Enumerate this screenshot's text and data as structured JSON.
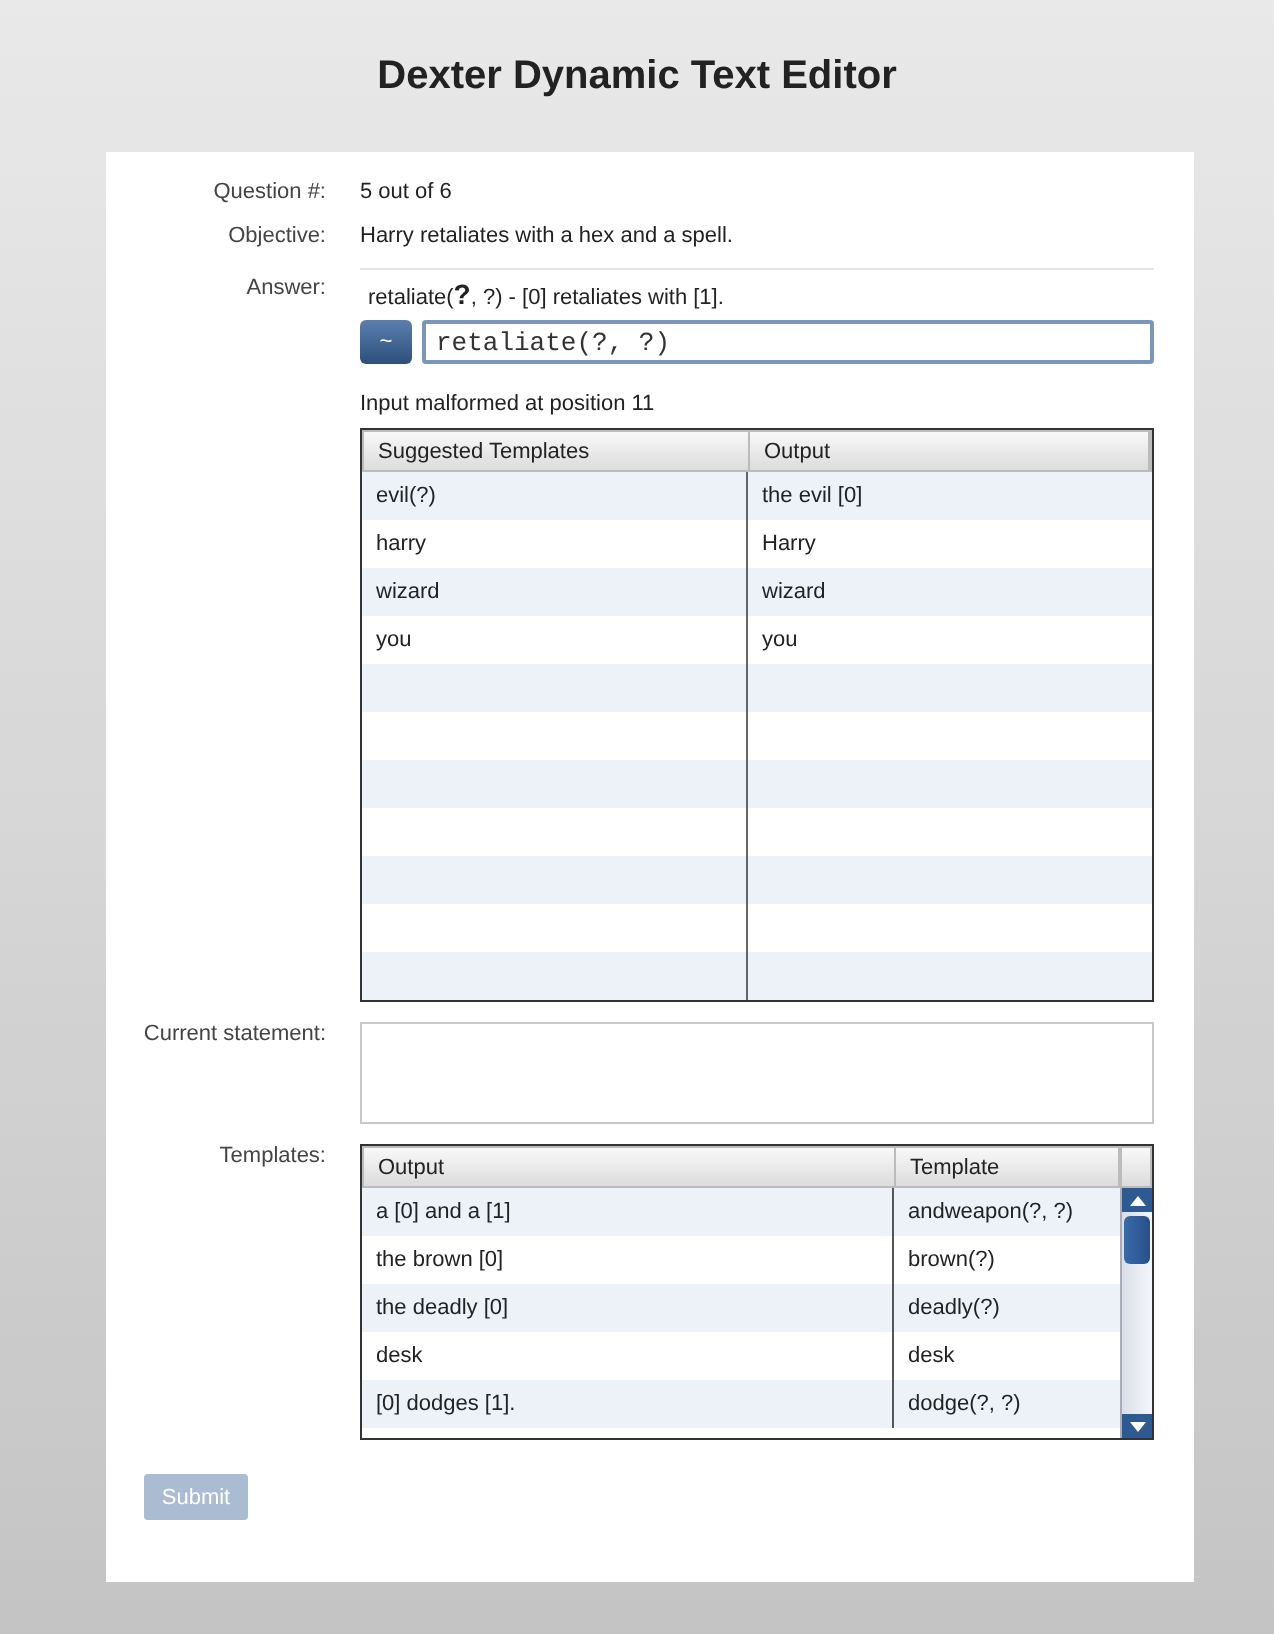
{
  "title": "Dexter Dynamic Text Editor",
  "question": {
    "label": "Question #:",
    "value": "5 out of 6"
  },
  "objective": {
    "label": "Objective:",
    "value": "Harry retaliates with a hex and a spell."
  },
  "answer": {
    "label": "Answer:",
    "hint": "retaliate(**?**, ?) - [0] retaliates with [1].",
    "toggle": "~",
    "value": "retaliate(?, ?)",
    "status": "Input malformed at position 11"
  },
  "suggestions": {
    "columns": [
      "Suggested Templates",
      "Output"
    ],
    "rows": [
      [
        "evil(?)",
        "the evil [0]"
      ],
      [
        "harry",
        "Harry"
      ],
      [
        "wizard",
        "wizard"
      ],
      [
        "you",
        "you"
      ]
    ]
  },
  "current_statement": {
    "label": "Current statement:"
  },
  "templates": {
    "label": "Templates:",
    "columns": [
      "Output",
      "Template"
    ],
    "rows": [
      [
        "a [0] and a [1]",
        "andweapon(?, ?)"
      ],
      [
        "the brown [0]",
        "brown(?)"
      ],
      [
        "the deadly [0]",
        "deadly(?)"
      ],
      [
        "desk",
        "desk"
      ],
      [
        "[0] dodges [1].",
        "dodge(?, ?)"
      ]
    ]
  },
  "submit": {
    "label": "Submit",
    "disabled": true
  }
}
